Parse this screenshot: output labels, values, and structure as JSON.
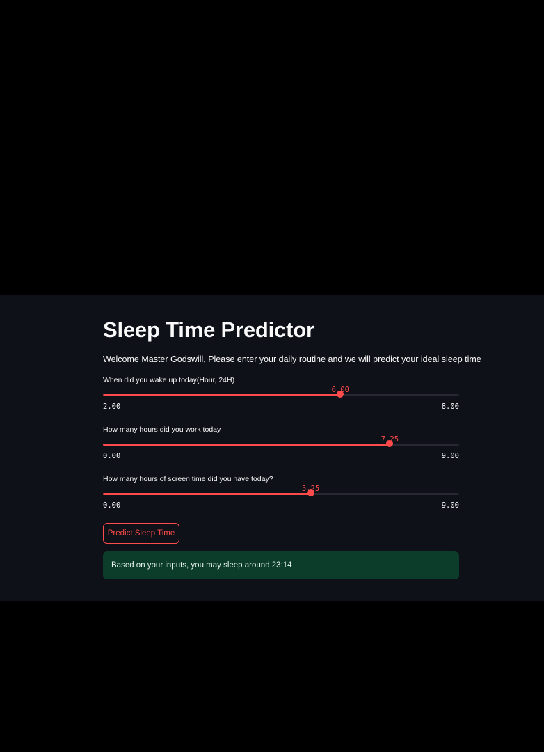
{
  "app": {
    "title": "Sleep Time Predictor",
    "welcome": "Welcome Master Godswill, Please enter your daily routine and we will predict your ideal sleep time"
  },
  "sliders": [
    {
      "label": "When did you wake up today(Hour, 24H)",
      "value": 6.0,
      "value_text": "6.00",
      "min": 2.0,
      "max": 8.0,
      "min_text": "2.00",
      "max_text": "8.00"
    },
    {
      "label": "How many hours did you work today",
      "value": 7.25,
      "value_text": "7.25",
      "min": 0.0,
      "max": 9.0,
      "min_text": "0.00",
      "max_text": "9.00"
    },
    {
      "label": "How many hours of screen time did you have today?",
      "value": 5.25,
      "value_text": "5.25",
      "min": 0.0,
      "max": 9.0,
      "min_text": "0.00",
      "max_text": "9.00"
    }
  ],
  "button": {
    "label": "Predict Sleep Time"
  },
  "result": {
    "text": "Based on your inputs, you may sleep around 23:14"
  },
  "colors": {
    "accent": "#ff4b4b",
    "background": "#0e1117",
    "outer": "#000000",
    "success_bg": "#0b3d2a",
    "text": "#fafafa",
    "track": "#262730"
  }
}
